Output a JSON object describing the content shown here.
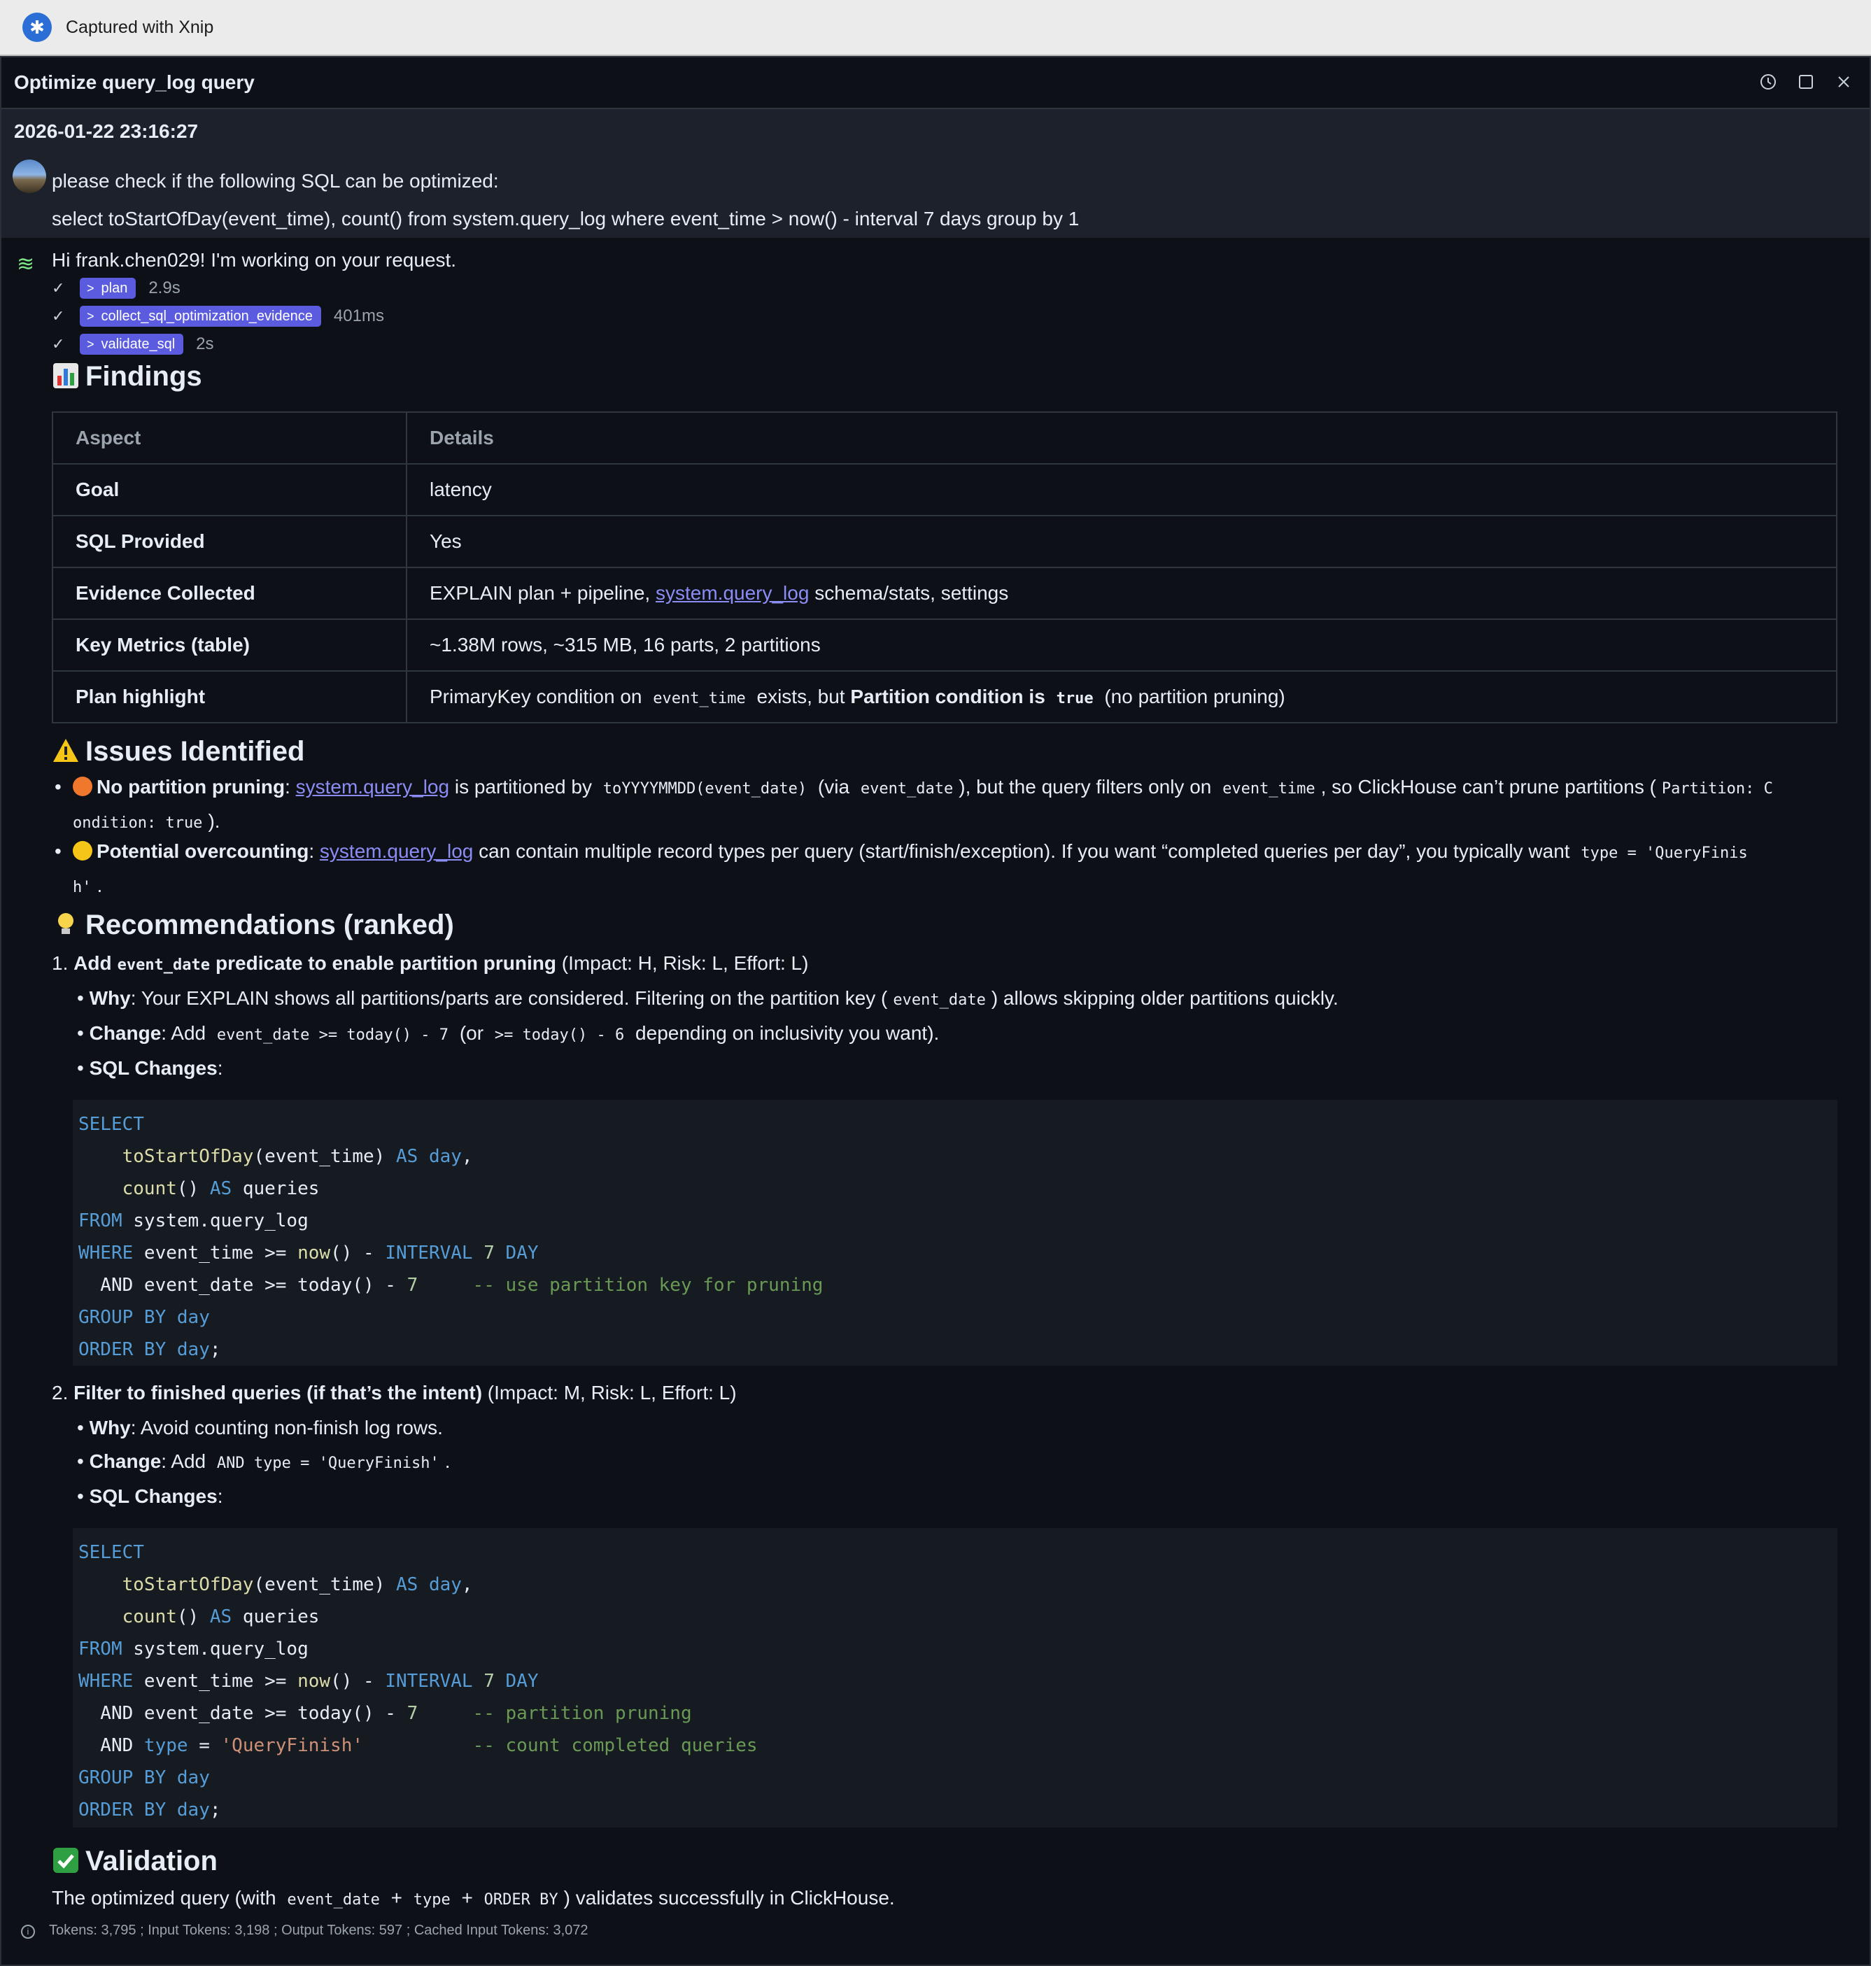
{
  "capture": {
    "title": "Captured with Xnip"
  },
  "window": {
    "title": "Optimize query_log query"
  },
  "user": {
    "timestamp": "2026-01-22 23:16:27",
    "line1": "please check if the following SQL can be optimized:",
    "line2": "select toStartOfDay(event_time), count() from system.query_log where event_time > now() - interval 7 days group by 1"
  },
  "assistant": {
    "greeting": "Hi frank.chen029! I'm working on your request.",
    "steps": [
      {
        "name": "plan",
        "duration": "2.9s"
      },
      {
        "name": "collect_sql_optimization_evidence",
        "duration": "401ms"
      },
      {
        "name": "validate_sql",
        "duration": "2s"
      }
    ]
  },
  "findings": {
    "heading": "Findings",
    "col1": "Aspect",
    "col2": "Details",
    "rows": [
      {
        "k": "Goal",
        "v": "latency"
      },
      {
        "k": "SQL Provided",
        "v": "Yes"
      },
      {
        "k": "Evidence Collected",
        "pre": "EXPLAIN plan + pipeline, ",
        "link": "system.query_log",
        "post": " schema/stats, settings"
      },
      {
        "k": "Key Metrics (table)",
        "v": "~1.38M rows, ~315 MB, 16 parts, 2 partitions"
      },
      {
        "k": "Plan highlight",
        "a": "PrimaryKey condition on ",
        "c1": "event_time",
        "b": " exists, but ",
        "bold": "Partition condition is",
        "c2": "true",
        "d": " (no partition pruning)"
      }
    ]
  },
  "issues": {
    "heading": "Issues Identified",
    "i1": {
      "bold": "No partition pruning",
      "link": "system.query_log",
      "t1": " is partitioned by ",
      "c1": "toYYYYMMDD(event_date)",
      "t2": " (via ",
      "c2": "event_date",
      "t3": "), but the query filters only on ",
      "c3": "event_time",
      "t4": ", so ClickHouse can’t prune partitions (",
      "c4a": "Partition: C",
      "c4b": "ondition: true",
      "t5": ")."
    },
    "i2": {
      "bold": "Potential overcounting",
      "link": "system.query_log",
      "t1": " can contain multiple record types per query (start/finish/exception). If you want “completed queries per day”, you typically want ",
      "c1a": "type = 'QueryFinis",
      "c1b": "h'",
      "t2": "."
    }
  },
  "recs": {
    "heading": "Recommendations (ranked)",
    "r1": {
      "num": "1.",
      "bold_a": "Add",
      "code": "event_date",
      "bold_b": "predicate to enable partition pruning",
      "meta": " (Impact: H, Risk: L, Effort: L)",
      "why_l": "Why",
      "why": ": Your EXPLAIN shows all partitions/parts are considered. Filtering on the partition key (",
      "why_c": "event_date",
      "why_e": ") allows skipping older partitions quickly.",
      "chg_l": "Change",
      "chg": ": Add ",
      "chg_c1": "event_date >= today() - 7",
      "chg_m": " (or ",
      "chg_c2": ">= today() - 6",
      "chg_e": " depending on inclusivity you want).",
      "sql_l": "SQL Changes"
    },
    "r2": {
      "num": "2.",
      "bold": "Filter to finished queries (if that’s the intent)",
      "meta": " (Impact: M, Risk: L, Effort: L)",
      "why_l": "Why",
      "why": ": Avoid counting non-finish log rows.",
      "chg_l": "Change",
      "chg": ": Add ",
      "chg_c": "AND type = 'QueryFinish'",
      "chg_e": ".",
      "sql_l": "SQL Changes"
    }
  },
  "validation": {
    "heading": "Validation",
    "t1": "The optimized query (with ",
    "c1": "event_date",
    "t2": " + ",
    "c2": "type",
    "t3": " + ",
    "c3": "ORDER BY",
    "t4": ") validates successfully in ClickHouse."
  },
  "footer": "Tokens: 3,795 ; Input Tokens: 3,198 ; Output Tokens: 597 ; Cached Input Tokens: 3,072"
}
